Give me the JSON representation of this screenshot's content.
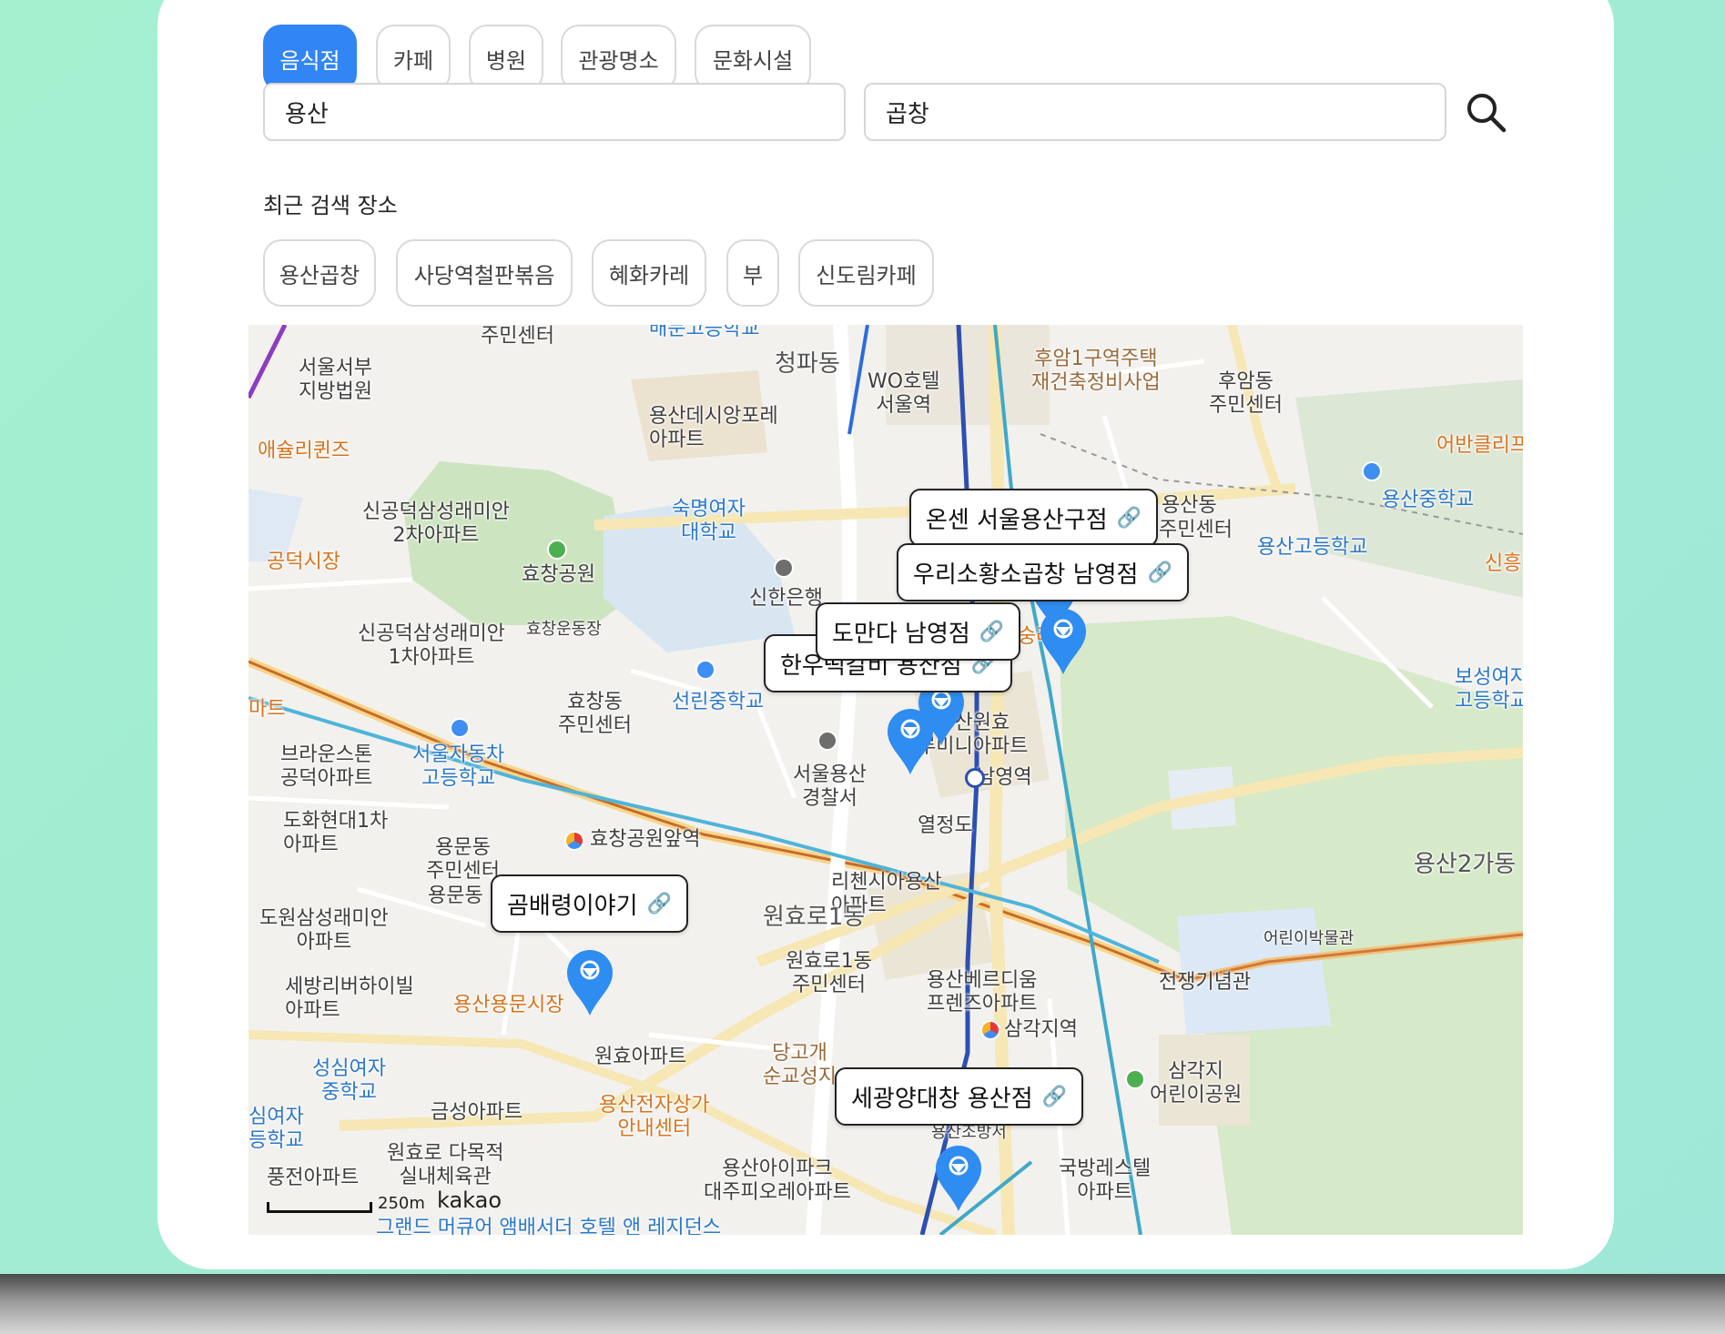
{
  "categories": [
    {
      "label": "음식점",
      "active": true
    },
    {
      "label": "카페",
      "active": false
    },
    {
      "label": "병원",
      "active": false
    },
    {
      "label": "관광명소",
      "active": false
    },
    {
      "label": "문화시설",
      "active": false
    }
  ],
  "search": {
    "region_value": "용산",
    "keyword_value": "곱창",
    "button_icon": "search-icon"
  },
  "recent": {
    "title": "최근 검색 장소",
    "items": [
      "용산곱창",
      "사당역철판볶음",
      "혜화카레",
      "부",
      "신도림카페"
    ]
  },
  "map": {
    "provider": "kakao",
    "scale_label": "250m",
    "results": [
      "온센 서울용산구점",
      "우리소황소곱창 남영점",
      "도만다 남영점",
      "한우떡갈비 용산점",
      "곰배령이야기",
      "세광양대창 용산점"
    ],
    "labels": {
      "a": "주민센터",
      "b": "배문고등학교",
      "c": "청파동",
      "d": "서울서부\n지방법원",
      "e": "WO호텔\n서울역",
      "f": "후암1구역주택\n재건축정비사업",
      "g": "후암동\n주민센터",
      "h": "용산데시앙포레\n아파트",
      "i": "애슐리퀸즈",
      "j": "숙명여자\n대학교",
      "k": "신공덕삼성래미안\n2차아파트",
      "l": "공덕시장",
      "m": "효창공원",
      "n": "신한은행",
      "o": "신공덕삼성래미안\n1차아파트",
      "p": "효창운동장",
      "q": "숭례문",
      "r": "마트",
      "s": "효창동\n주민센터",
      "t": "선린중학교",
      "u": "브라운스톤\n공덕아파트",
      "v": "서울자동차\n고등학교",
      "w": "용산원효\n루미니아파트",
      "x": "서울용산\n경찰서",
      "y": "남영역",
      "z": "도화현대1차\n아파트",
      "aa": "효창공원앞역",
      "ab": "열정도",
      "ac": "용문동\n주민센터",
      "ad": "리첸시아용산\n아파트",
      "ae": "도원삼성래미안\n아파트",
      "af": "원효로1동",
      "ag": "원효로1동\n주민센터",
      "ah": "세방리버하이빌\n아파트",
      "ai": "용산용문시장",
      "aj": "용산베르디움\n프렌즈아파트",
      "ak": "원효아파트",
      "al": "당고개\n순교성지",
      "am": "삼각지역",
      "an": "성심여자\n중학교",
      "ao": "금성아파트",
      "ap": "용산전자상가\n안내센터",
      "aq": "삼각지\n어린이공원",
      "ar": "심여자\n등학교",
      "as": "원효로 다목적\n실내체육관",
      "at": "용산아이파크\n대주피오레아파트",
      "au": "국방레스텔\n아파트",
      "av": "풍전아파트",
      "aw": "용산2가동",
      "ax": "어린이박물관",
      "ay": "전쟁기념관",
      "az": "용산중학교",
      "ba": "용산고등학교",
      "bb": "어반클리프",
      "bc": "신흥",
      "bd": "보성여자\n고등학교",
      "be": "용산조방서",
      "bf": "그랜드 머큐어 앰배서더 호텔 앤 레지던스",
      "bg": "용산동",
      "bh": "주민센터",
      "bi": "용문동"
    }
  }
}
